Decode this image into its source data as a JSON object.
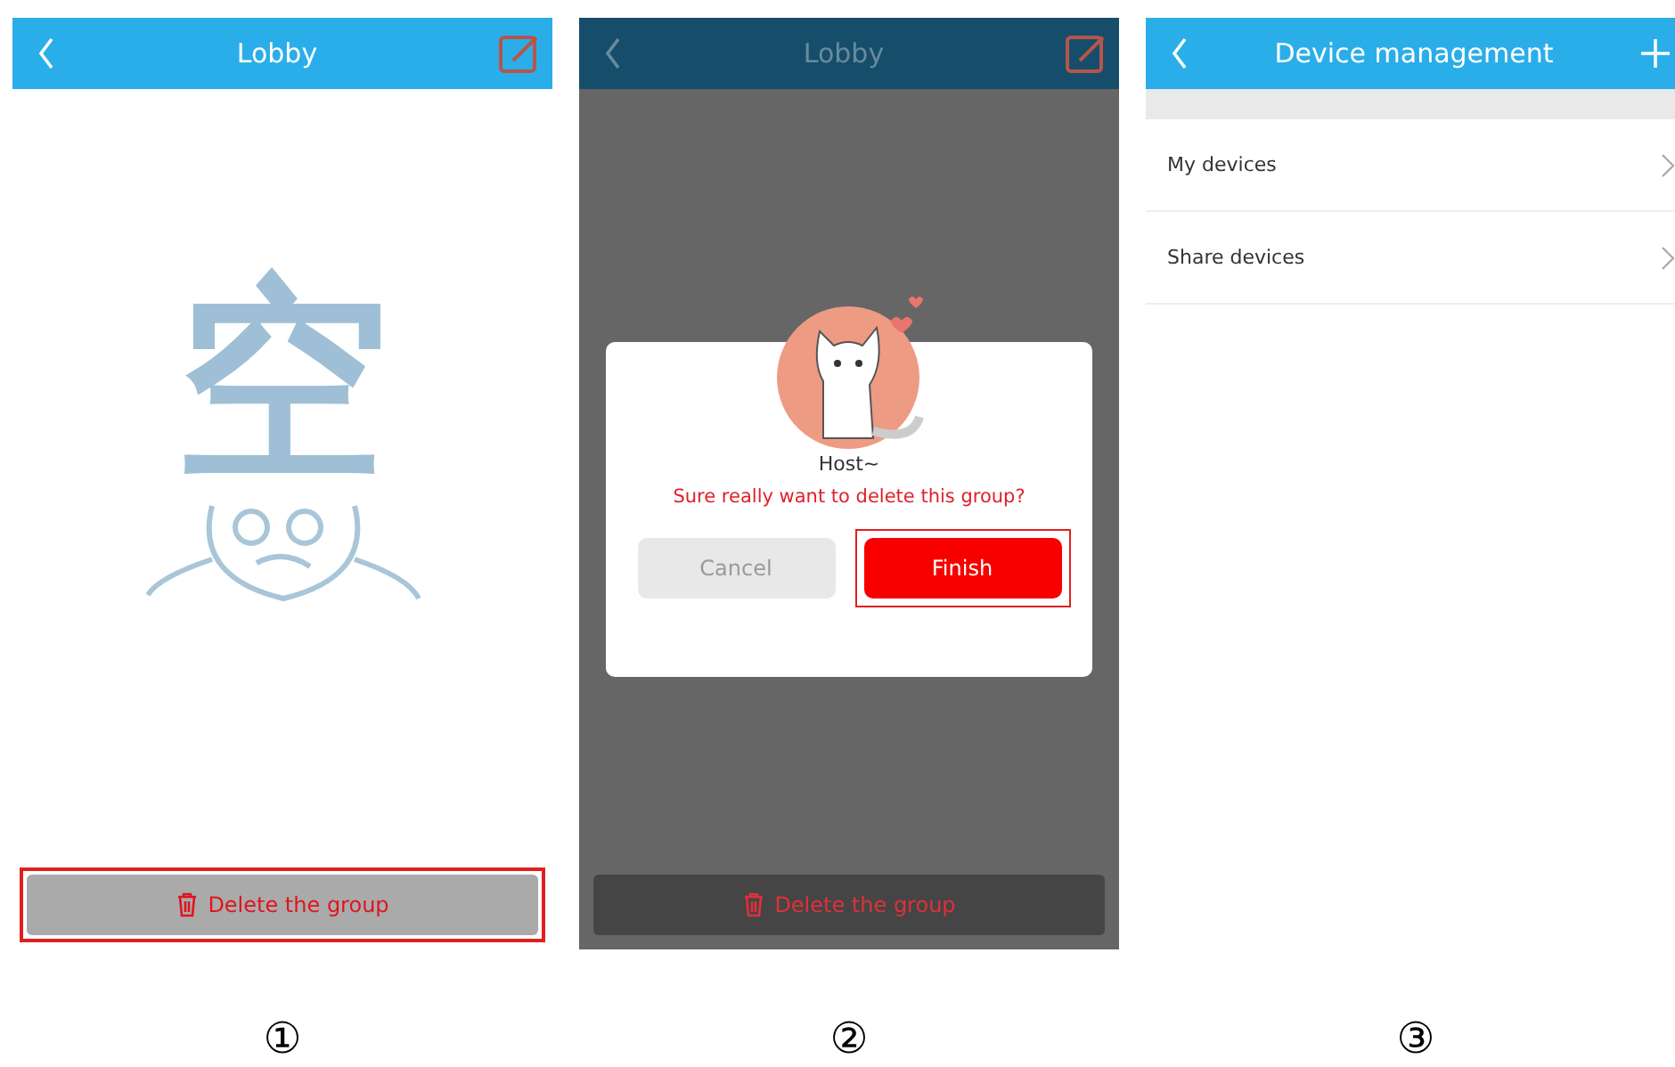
{
  "panels": [
    {
      "kind": "lobby",
      "caption": "①",
      "header": {
        "title": "Lobby",
        "kind": "edit"
      },
      "empty_art_text": "空",
      "delete_button": {
        "label": "Delete the group",
        "highlighted": true
      }
    },
    {
      "kind": "lobby_dialog",
      "caption": "②",
      "header": {
        "title": "Lobby",
        "kind": "edit"
      },
      "delete_button": {
        "label": "Delete the group",
        "highlighted": false
      },
      "dialog": {
        "title": "Host~",
        "message": "Sure really want to delete this group?",
        "buttons": [
          {
            "label": "Cancel",
            "disabled": true,
            "highlighted": false
          },
          {
            "label": "Finish",
            "disabled": false,
            "highlighted": true
          }
        ]
      }
    },
    {
      "kind": "device_list",
      "caption": "③",
      "header": {
        "title": "Device management",
        "kind": "add"
      },
      "items": [
        {
          "label": "My devices"
        },
        {
          "label": "Share devices"
        }
      ]
    }
  ]
}
